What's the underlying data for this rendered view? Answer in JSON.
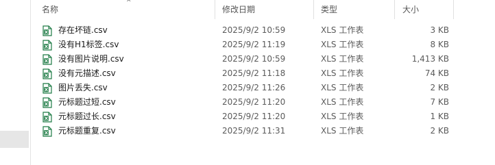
{
  "columns": {
    "name": "名称",
    "date": "修改日期",
    "type": "类型",
    "size": "大小",
    "sort_indicator": "^"
  },
  "files": [
    {
      "name": "存在坏链.csv",
      "date": "2025/9/2 10:59",
      "type": "XLS 工作表",
      "size": "3 KB",
      "icon": "csv-file-icon"
    },
    {
      "name": "没有H1标签.csv",
      "date": "2025/9/2 11:19",
      "type": "XLS 工作表",
      "size": "8 KB",
      "icon": "csv-file-icon"
    },
    {
      "name": "没有图片说明.csv",
      "date": "2025/9/2 10:59",
      "type": "XLS 工作表",
      "size": "1,413 KB",
      "icon": "csv-file-icon"
    },
    {
      "name": "没有元描述.csv",
      "date": "2025/9/2 11:18",
      "type": "XLS 工作表",
      "size": "74 KB",
      "icon": "csv-file-icon"
    },
    {
      "name": "图片丢失.csv",
      "date": "2025/9/2 11:26",
      "type": "XLS 工作表",
      "size": "2 KB",
      "icon": "csv-file-icon"
    },
    {
      "name": "元标题过短.csv",
      "date": "2025/9/2 11:20",
      "type": "XLS 工作表",
      "size": "7 KB",
      "icon": "csv-file-icon"
    },
    {
      "name": "元标题过长.csv",
      "date": "2025/9/2 11:20",
      "type": "XLS 工作表",
      "size": "1 KB",
      "icon": "csv-file-icon"
    },
    {
      "name": "元标题重复.csv",
      "date": "2025/9/2 11:31",
      "type": "XLS 工作表",
      "size": "2 KB",
      "icon": "csv-file-icon"
    }
  ],
  "colors": {
    "icon_green": "#1e7b45",
    "header_text": "#555555",
    "secondary_text": "#5a5a5a"
  }
}
